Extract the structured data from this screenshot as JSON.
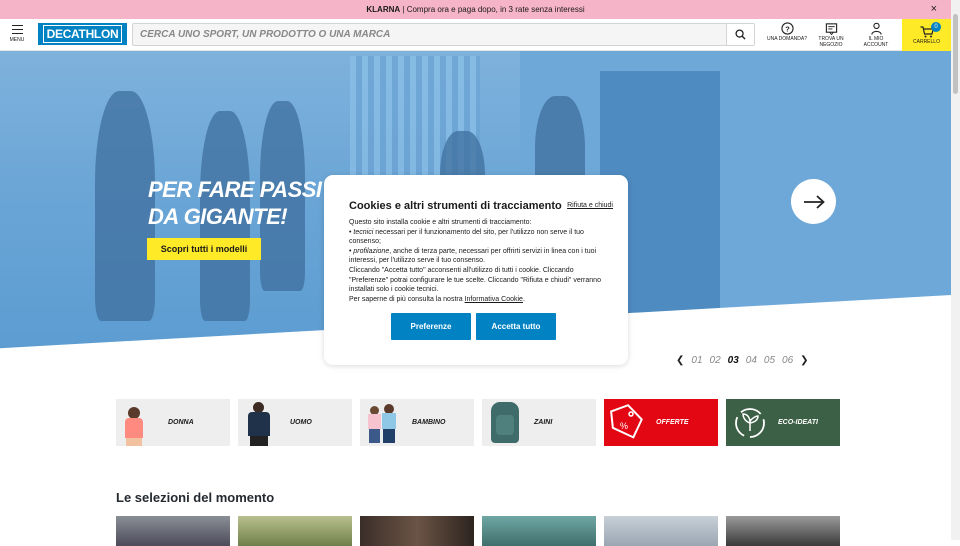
{
  "promo": {
    "brand": "KLARNA",
    "text": "| Compra ora e paga dopo, in 3 rate senza interessi",
    "close": "×"
  },
  "header": {
    "menu_label": "MENU",
    "logo_text": "DECATHLON",
    "search_placeholder": "CERCA UNO SPORT, UN PRODOTTO O UNA MARCA",
    "help_label": "UNA DOMANDA?",
    "store_label_1": "TROVA UN",
    "store_label_2": "NEGOZIO",
    "account_label_1": "IL MIO",
    "account_label_2": "ACCOUNT",
    "cart_label": "CARRELLO",
    "cart_count": "0"
  },
  "hero": {
    "title_line1": "PER FARE PASSI",
    "title_line2": "DA GIGANTE!",
    "cta": "Scopri tutti i modelli",
    "pager": [
      "01",
      "02",
      "03",
      "04",
      "05",
      "06"
    ],
    "active_page": "03"
  },
  "categories": [
    {
      "label": "DONNA"
    },
    {
      "label": "UOMO"
    },
    {
      "label": "BAMBINO"
    },
    {
      "label": "ZAINI"
    },
    {
      "label": "OFFERTE"
    },
    {
      "label": "ECO-IDEATI"
    }
  ],
  "section": {
    "title": "Le selezioni del momento"
  },
  "cookie_modal": {
    "title": "Cookies e altri strumenti di tracciamento",
    "reject_link": "Rifiuta e chiudi",
    "intro": "Questo sito installa cookie e altri strumenti di tracciamento:",
    "bullet1_em": "tecnici",
    "bullet1_rest": "necessari per il funzionamento del sito, per l'utilizzo non serve il tuo consenso;",
    "bullet2_em": "profilazione",
    "bullet2_rest": ", anche di terza parte, necessari per offrirti servizi in linea con i tuoi interessi, per l'utilizzo serve il tuo consenso.",
    "para2": "Cliccando \"Accetta tutto\" acconsenti all'utilizzo di tutti i cookie. Cliccando \"Preferenze\" potrai configurare le tue scelte. Cliccando \"Rifiuta e chiudi\" verranno installati solo i cookie tecnici.",
    "para3_pre": "Per saperne di più consulta la nostra",
    "policy_link": "Informativa Cookie",
    "preferences_button": "Preferenze",
    "accept_button": "Accetta tutto"
  },
  "colors": {
    "brand_blue": "#0082c3",
    "yellow": "#ffea28",
    "promo_pink": "#f5b4c8",
    "offer_red": "#e30613",
    "eco_green": "#3c6045"
  }
}
